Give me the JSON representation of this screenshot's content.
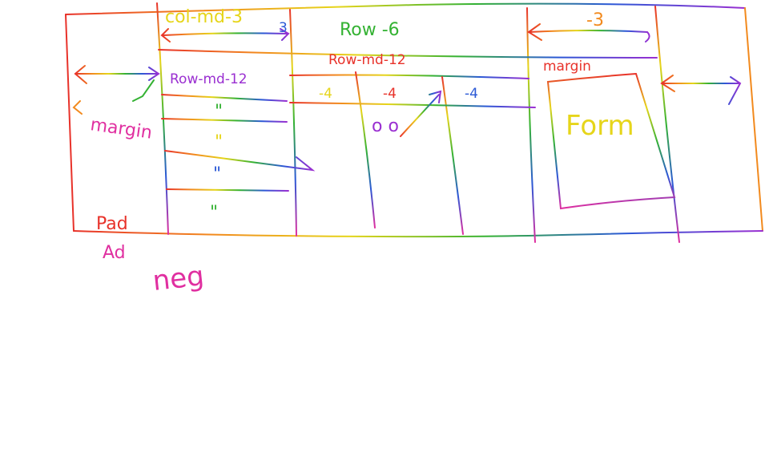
{
  "labels": {
    "col_md_3": "col-md-3",
    "col_md_3_suffix": "3",
    "row_6": "Row -6",
    "right_3": "-3",
    "row_md_12_top": "Row-md-12",
    "row_md_12_left": "Row-md-12",
    "cell_4_a": "-4",
    "cell_4_b": "-4",
    "cell_4_c": "-4",
    "circles": "o o",
    "margin": "margin",
    "form": "Form",
    "ditto_1": "\"",
    "ditto_2": "\"",
    "ditto_3": "\"",
    "ditto_4": "\"",
    "left_margin_lines": [
      "margin",
      "Pad",
      "Ad",
      "neg"
    ]
  },
  "colors": {
    "red": "#e8322a",
    "orange": "#f28a1e",
    "yellow": "#e6d51a",
    "green": "#34b233",
    "blue": "#2b59d6",
    "purple": "#9a2fd1",
    "magenta": "#e02fa0"
  }
}
